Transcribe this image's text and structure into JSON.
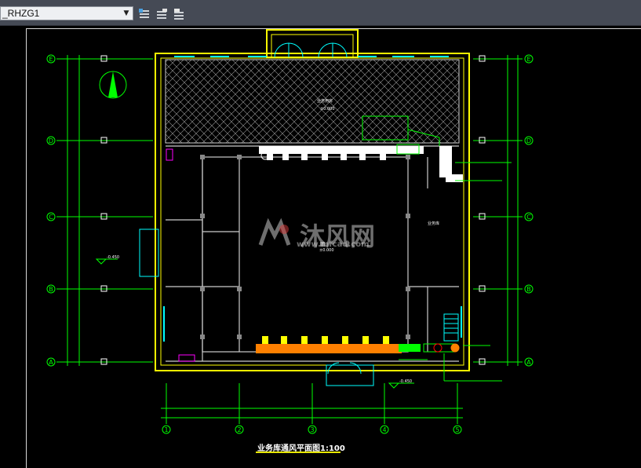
{
  "toolbar": {
    "layer_value": "_RHZG1",
    "icons": [
      "layer-state-icon",
      "layer-iso-icon",
      "layer-freeze-icon"
    ]
  },
  "drawing": {
    "title": "业务库通风平面图1:100",
    "grid_rows": [
      "E",
      "D",
      "C",
      "B",
      "A"
    ],
    "grid_cols": [
      "1",
      "2",
      "3",
      "4",
      "5"
    ],
    "level_left": "-0.450",
    "level_bottom": "-0.450",
    "room_top": "业务用房",
    "room_top_level": "±0.000",
    "room_center_level": "±0.000",
    "room_right": "业务库",
    "watermark_cn": "沐风网",
    "watermark_en": "www.mfcad.com"
  },
  "colors": {
    "background": "#000000",
    "toolbar": "#454a55",
    "grid_line": "#00ff00",
    "wall": "#ffff00",
    "duct": "#ffffff",
    "duct_orange": "#ff8000",
    "cyan": "#00ffff"
  }
}
